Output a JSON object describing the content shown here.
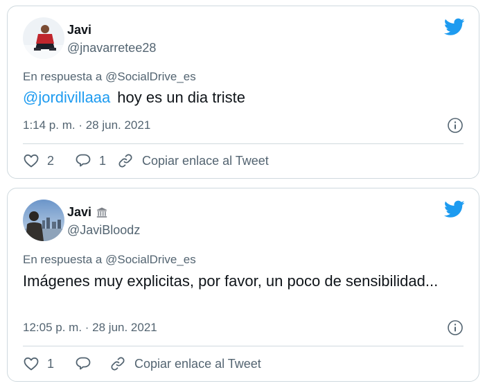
{
  "tweets": [
    {
      "display_name": "Javi",
      "handle": "@jnavarretee28",
      "reply_prefix": "En respuesta a",
      "reply_to": "@SocialDrive_es",
      "mention": "@jordivillaaa",
      "text": "hoy es un dia triste",
      "timestamp": "1:14 p. m. · 28 jun. 2021",
      "likes": "2",
      "replies": "1",
      "copy_label": "Copiar enlace al Tweet",
      "avatar_icon": "user-avatar-snow",
      "has_badge": false
    },
    {
      "display_name": "Javi",
      "badge_icon": "classical-building-icon",
      "handle": "@JaviBloodz",
      "reply_prefix": "En respuesta a",
      "reply_to": "@SocialDrive_es",
      "text": "Imágenes muy explicitas, por favor, un poco de sensibilidad...",
      "timestamp": "12:05 p. m. · 28 jun. 2021",
      "likes": "1",
      "copy_label": "Copiar enlace al Tweet",
      "avatar_icon": "user-avatar-city",
      "has_badge": true
    }
  ],
  "colors": {
    "accent": "#1d9bf0",
    "text_primary": "#0f1419",
    "text_secondary": "#536471",
    "border": "#cfd9de"
  }
}
